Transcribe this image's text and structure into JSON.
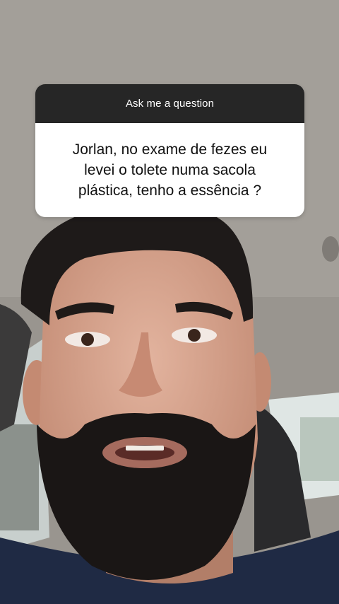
{
  "story": {
    "question_sticker": {
      "header": "Ask me a question",
      "question": "Jorlan, no exame de fezes eu levei o tolete numa sacola plástica, tenho a essência ?",
      "header_color": "#262626",
      "body_color": "#ffffff"
    }
  }
}
